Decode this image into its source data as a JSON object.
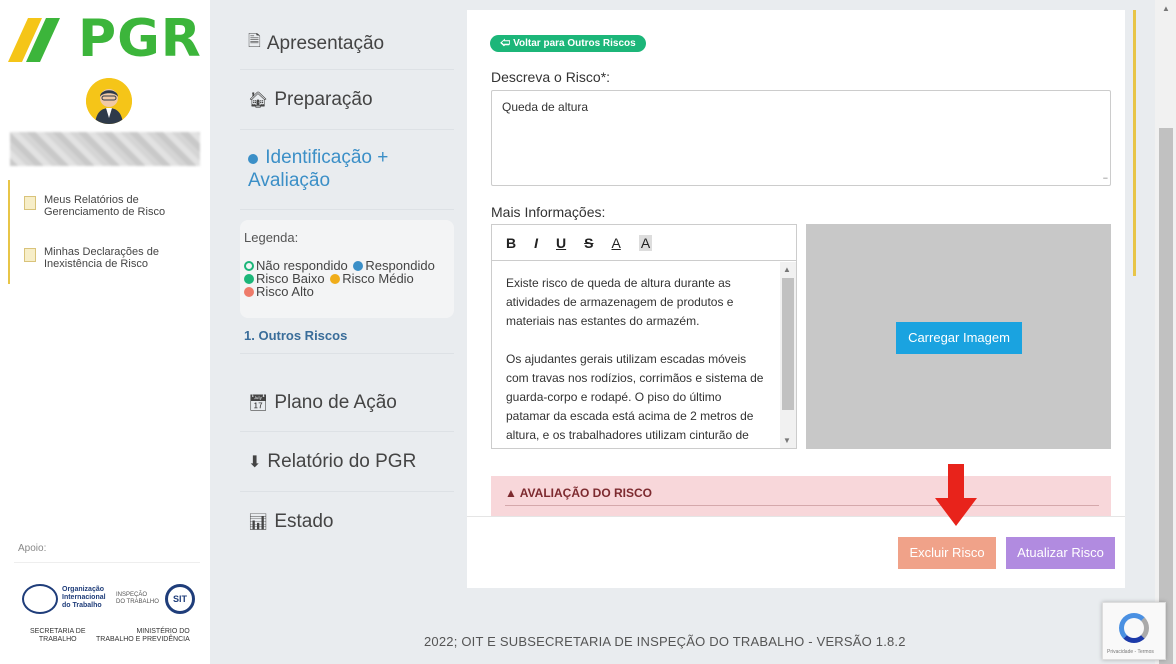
{
  "branding": {
    "logo_text": "PGR"
  },
  "sidebar": {
    "items": [
      {
        "label": "Meus Relatórios de\nGerenciamento de Risco"
      },
      {
        "label": "Minhas Declarações de\nInexistência de Risco"
      }
    ],
    "apoio": "Apoio:",
    "oit_name": "Organização\nInternacional\ndo Trabalho",
    "inspecao": "INSPEÇÃO\nDO TRABALHO",
    "sit": "SIT",
    "secretaria": "SECRETARIA DE\nTRABALHO",
    "ministerio": "MINISTÉRIO DO\nTRABALHO E PREVIDÊNCIA"
  },
  "steps": {
    "items": [
      {
        "label": "Apresentação",
        "icon": "file-icon"
      },
      {
        "label": "Preparação",
        "icon": "home-icon"
      },
      {
        "label": "Identificação + Avaliação",
        "icon": "check-circle-icon"
      },
      {
        "label": "Plano de Ação",
        "icon": "calendar-icon"
      },
      {
        "label": "Relatório do PGR",
        "icon": "download-icon"
      },
      {
        "label": "Estado",
        "icon": "bar-chart-icon"
      }
    ],
    "legend": {
      "title": "Legenda:",
      "not_answered": "Não respondido",
      "answered": "Respondido",
      "low": "Risco Baixo",
      "medium": "Risco Médio",
      "high": "Risco Alto"
    },
    "sub_step": "1. Outros Riscos"
  },
  "form": {
    "back_button": "Voltar para Outros Riscos",
    "describe_label": "Descreva o Risco*:",
    "describe_value": "Queda de altura",
    "more_label": "Mais Informações:",
    "toolbar": [
      "B",
      "I",
      "U",
      "S",
      "A",
      "A"
    ],
    "editor_paragraphs": [
      "Existe risco de queda de altura durante as atividades de armazenagem de produtos e materiais nas estantes do armazém.",
      "Os ajudantes gerais utilizam escadas móveis com travas nos rodízios, corrimãos e sistema de guarda-corpo e rodapé. O piso do último patamar da escada está acima de 2 metros de altura, e os trabalhadores utilizam cinturão de"
    ],
    "upload_button": "Carregar Imagem",
    "risk_section": "AVALIAÇÃO DO RISCO",
    "delete_button": "Excluir Risco",
    "update_button": "Atualizar Risco"
  },
  "footer": {
    "copyright": "2022; OIT E SUBSECRETARIA DE INSPEÇÃO DO TRABALHO - VERSÃO 1.8.2"
  },
  "recaptcha": {
    "terms": "Privacidade - Termos"
  },
  "colors": {
    "brand_green": "#3cb53b",
    "accent_yellow": "#e8c547",
    "back_button": "#1cb679",
    "upload": "#1aa3e0",
    "delete": "#f0a289",
    "update": "#b18be0",
    "annotation_arrow": "#e8231b"
  }
}
